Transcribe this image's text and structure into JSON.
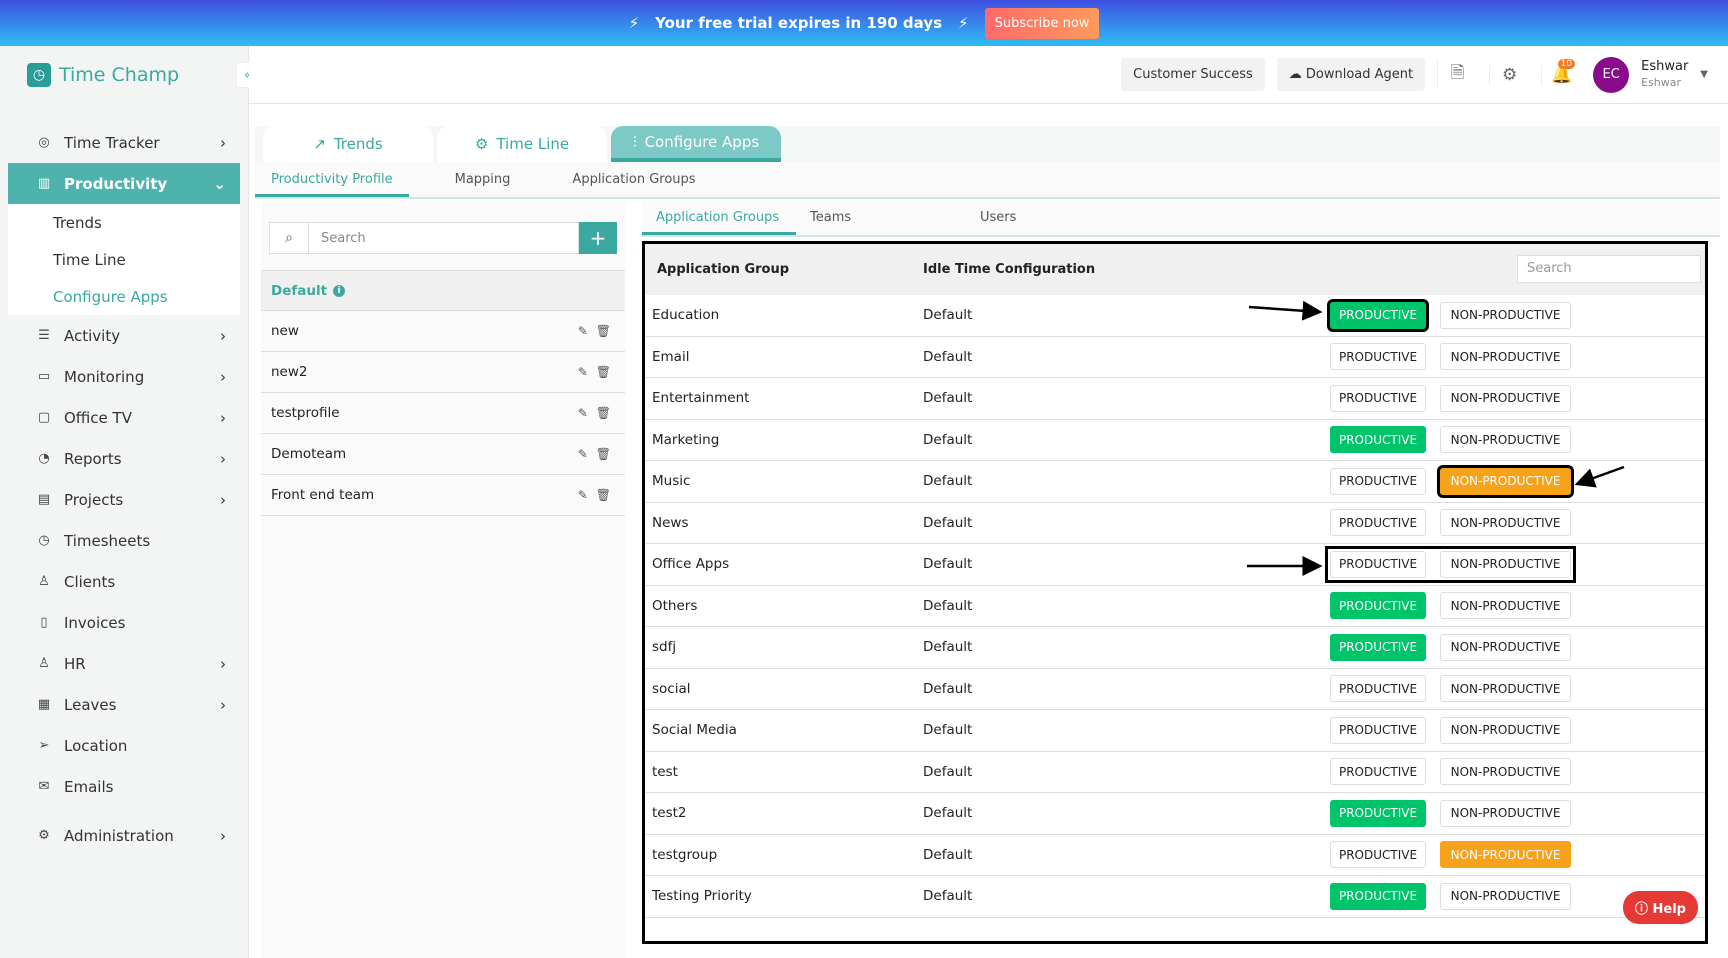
{
  "banner": {
    "text": "Your free trial expires in 190 days",
    "subscribe": "Subscribe now"
  },
  "brand": {
    "name": "Time Champ",
    "accent": "#3aa9a2"
  },
  "header": {
    "customer_success": "Customer Success",
    "download_agent": "Download Agent",
    "notifications": "10",
    "avatar_initials": "EC",
    "user_name": "Eshwar",
    "user_sub": "Eshwar"
  },
  "sidebar": {
    "items": [
      {
        "label": "Time Tracker",
        "icon": "clock-icon",
        "chev": true
      },
      {
        "label": "Productivity",
        "icon": "chart-icon",
        "chev": true,
        "active": true
      },
      {
        "label": "Activity",
        "icon": "activity-icon",
        "chev": true
      },
      {
        "label": "Monitoring",
        "icon": "monitor-icon",
        "chev": true
      },
      {
        "label": "Office TV",
        "icon": "tv-icon",
        "chev": true
      },
      {
        "label": "Reports",
        "icon": "pie-icon",
        "chev": true
      },
      {
        "label": "Projects",
        "icon": "briefcase-icon",
        "chev": true
      },
      {
        "label": "Timesheets",
        "icon": "timer-icon",
        "chev": false
      },
      {
        "label": "Clients",
        "icon": "user-icon",
        "chev": false
      },
      {
        "label": "Invoices",
        "icon": "invoice-icon",
        "chev": false
      },
      {
        "label": "HR",
        "icon": "person-icon",
        "chev": true
      },
      {
        "label": "Leaves",
        "icon": "calendar-icon",
        "chev": true
      },
      {
        "label": "Location",
        "icon": "location-icon",
        "chev": false
      },
      {
        "label": "Emails",
        "icon": "mail-icon",
        "chev": false
      },
      {
        "label": "Administration",
        "icon": "gear-icon",
        "chev": true
      }
    ],
    "subitems": [
      "Trends",
      "Time Line",
      "Configure Apps"
    ]
  },
  "tabs": [
    "Trends",
    "Time Line",
    "Configure Apps"
  ],
  "subtabs": [
    "Productivity Profile",
    "Mapping",
    "Application Groups"
  ],
  "left": {
    "search_placeholder": "Search",
    "profiles": [
      "Default",
      "new",
      "new2",
      "testprofile",
      "Demoteam",
      "Front end team"
    ]
  },
  "right": {
    "tabs": [
      "Application Groups",
      "Teams",
      "Users"
    ],
    "col1": "Application Group",
    "col2": "Idle Time Configuration",
    "search_placeholder": "Search",
    "productive": "PRODUCTIVE",
    "nonproductive": "NON-PRODUCTIVE",
    "rows": [
      {
        "name": "Education",
        "idle": "Default",
        "state": "P",
        "box": "p"
      },
      {
        "name": "Email",
        "idle": "Default",
        "state": ""
      },
      {
        "name": "Entertainment",
        "idle": "Default",
        "state": ""
      },
      {
        "name": "Marketing",
        "idle": "Default",
        "state": "P"
      },
      {
        "name": "Music",
        "idle": "Default",
        "state": "N",
        "box": "n"
      },
      {
        "name": "News",
        "idle": "Default",
        "state": ""
      },
      {
        "name": "Office Apps",
        "idle": "Default",
        "state": "",
        "box": "both"
      },
      {
        "name": "Others",
        "idle": "Default",
        "state": "P"
      },
      {
        "name": "sdfj",
        "idle": "Default",
        "state": "P"
      },
      {
        "name": "social",
        "idle": "Default",
        "state": ""
      },
      {
        "name": "Social Media",
        "idle": "Default",
        "state": ""
      },
      {
        "name": "test",
        "idle": "Default",
        "state": ""
      },
      {
        "name": "test2",
        "idle": "Default",
        "state": "P"
      },
      {
        "name": "testgroup",
        "idle": "Default",
        "state": "N"
      },
      {
        "name": "Testing Priority",
        "idle": "Default",
        "state": "P"
      }
    ]
  },
  "help": "Help"
}
